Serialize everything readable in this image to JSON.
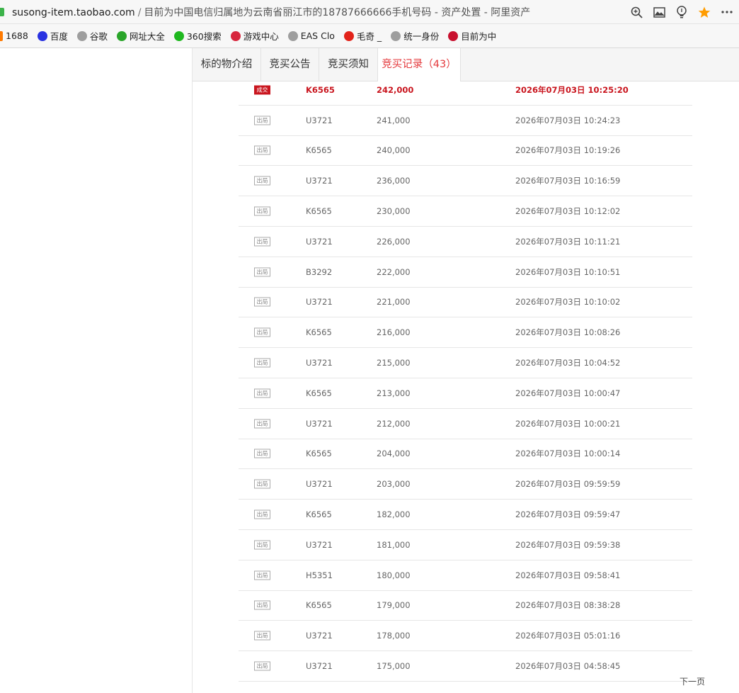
{
  "browser": {
    "domain": "susong-item.taobao.com",
    "separator": "/",
    "title": "目前为中国电信归属地为云南省丽江市的18787666666手机号码 - 资产处置 - 阿里资产"
  },
  "bookmarks": [
    {
      "label": "1688",
      "color": "#ff7a00"
    },
    {
      "label": "百度",
      "color": "#2932e1"
    },
    {
      "label": "谷歌",
      "color": "#9e9e9e"
    },
    {
      "label": "网址大全",
      "color": "#2aa52a"
    },
    {
      "label": "360搜索",
      "color": "#1fb81f"
    },
    {
      "label": "游戏中心",
      "color": "#d7263d"
    },
    {
      "label": "EAS Clo",
      "color": "#9e9e9e"
    },
    {
      "label": "毛奇 _",
      "color": "#e2231a"
    },
    {
      "label": "统一身份",
      "color": "#9e9e9e"
    },
    {
      "label": "目前为中",
      "color": "#c8102e"
    }
  ],
  "tabs": [
    {
      "label": "标的物介绍",
      "active": false
    },
    {
      "label": "竞买公告",
      "active": false
    },
    {
      "label": "竞买须知",
      "active": false
    },
    {
      "label": "竞买记录（43）",
      "active": true
    }
  ],
  "records": [
    {
      "status": "成交",
      "bidder": "K6565",
      "price": "242,000",
      "time": "2026年07月03日 10:25:20",
      "winning": true
    },
    {
      "status": "出局",
      "bidder": "U3721",
      "price": "241,000",
      "time": "2026年07月03日 10:24:23",
      "winning": false
    },
    {
      "status": "出局",
      "bidder": "K6565",
      "price": "240,000",
      "time": "2026年07月03日 10:19:26",
      "winning": false
    },
    {
      "status": "出局",
      "bidder": "U3721",
      "price": "236,000",
      "time": "2026年07月03日 10:16:59",
      "winning": false
    },
    {
      "status": "出局",
      "bidder": "K6565",
      "price": "230,000",
      "time": "2026年07月03日 10:12:02",
      "winning": false
    },
    {
      "status": "出局",
      "bidder": "U3721",
      "price": "226,000",
      "time": "2026年07月03日 10:11:21",
      "winning": false
    },
    {
      "status": "出局",
      "bidder": "B3292",
      "price": "222,000",
      "time": "2026年07月03日 10:10:51",
      "winning": false
    },
    {
      "status": "出局",
      "bidder": "U3721",
      "price": "221,000",
      "time": "2026年07月03日 10:10:02",
      "winning": false
    },
    {
      "status": "出局",
      "bidder": "K6565",
      "price": "216,000",
      "time": "2026年07月03日 10:08:26",
      "winning": false
    },
    {
      "status": "出局",
      "bidder": "U3721",
      "price": "215,000",
      "time": "2026年07月03日 10:04:52",
      "winning": false
    },
    {
      "status": "出局",
      "bidder": "K6565",
      "price": "213,000",
      "time": "2026年07月03日 10:00:47",
      "winning": false
    },
    {
      "status": "出局",
      "bidder": "U3721",
      "price": "212,000",
      "time": "2026年07月03日 10:00:21",
      "winning": false
    },
    {
      "status": "出局",
      "bidder": "K6565",
      "price": "204,000",
      "time": "2026年07月03日 10:00:14",
      "winning": false
    },
    {
      "status": "出局",
      "bidder": "U3721",
      "price": "203,000",
      "time": "2026年07月03日 09:59:59",
      "winning": false
    },
    {
      "status": "出局",
      "bidder": "K6565",
      "price": "182,000",
      "time": "2026年07月03日 09:59:47",
      "winning": false
    },
    {
      "status": "出局",
      "bidder": "U3721",
      "price": "181,000",
      "time": "2026年07月03日 09:59:38",
      "winning": false
    },
    {
      "status": "出局",
      "bidder": "H5351",
      "price": "180,000",
      "time": "2026年07月03日 09:58:41",
      "winning": false
    },
    {
      "status": "出局",
      "bidder": "K6565",
      "price": "179,000",
      "time": "2026年07月03日 08:38:28",
      "winning": false
    },
    {
      "status": "出局",
      "bidder": "U3721",
      "price": "178,000",
      "time": "2026年07月03日 05:01:16",
      "winning": false
    },
    {
      "status": "出局",
      "bidder": "U3721",
      "price": "175,000",
      "time": "2026年07月03日 04:58:45",
      "winning": false
    }
  ],
  "pagination": {
    "next_label": "下一页"
  },
  "icons": {
    "zoom": "zoom-icon",
    "screenshot": "image-icon",
    "lightbulb": "lightbulb-icon",
    "star": "star-icon",
    "menu": "more-icon"
  },
  "colors": {
    "accent": "#e4393c",
    "win": "#c9151e",
    "star": "#ff9c00",
    "lock": "#3cb34a"
  }
}
